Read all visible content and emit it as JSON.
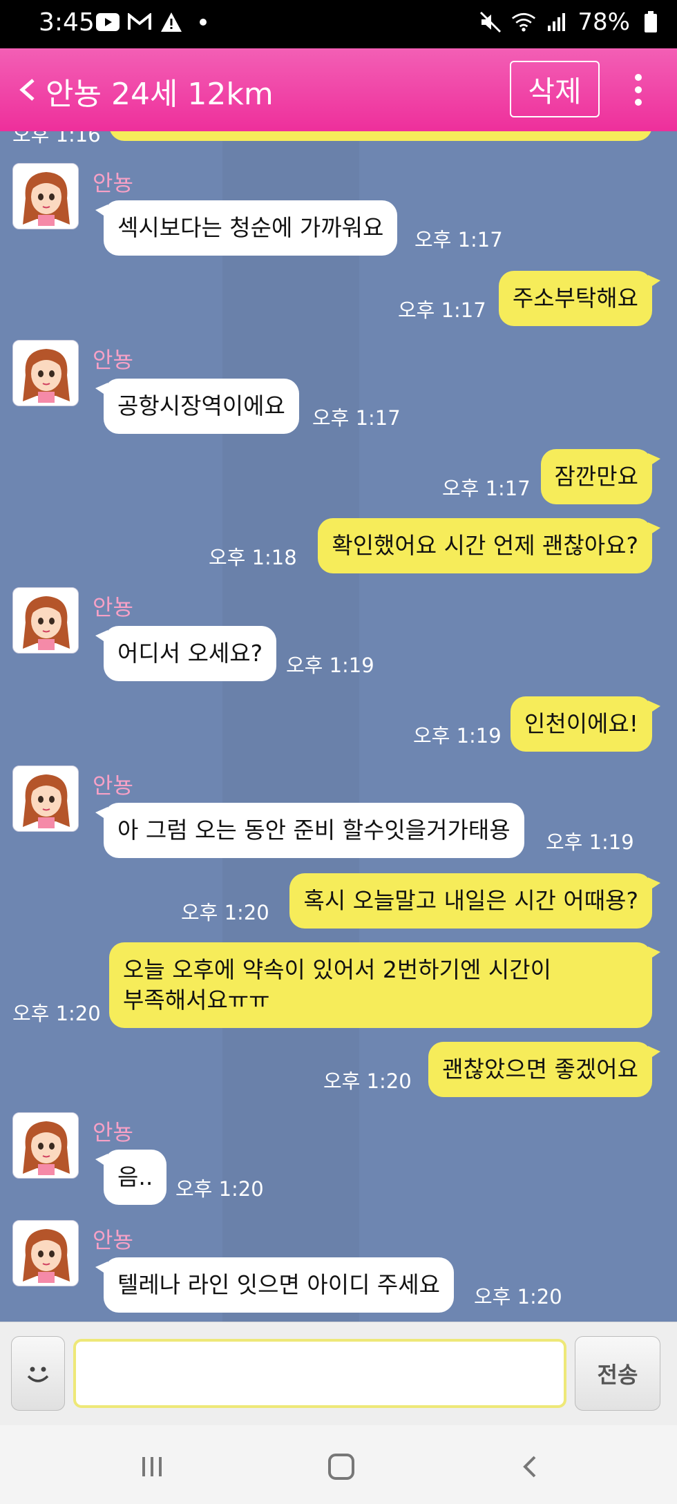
{
  "status_bar": {
    "time": "3:45",
    "battery": "78%",
    "icons_left": [
      "youtube-icon",
      "gmail-icon",
      "warning-icon",
      "dot-icon"
    ],
    "icons_right": [
      "mute-icon",
      "wifi-icon",
      "signal-icon",
      "battery-icon"
    ]
  },
  "header": {
    "title": "안뇽 24세 12km",
    "delete_label": "삭제"
  },
  "colors": {
    "header_pink": "#ee2f9b",
    "chat_bg": "#6e86b1",
    "outgoing_bubble": "#f6ec5a",
    "incoming_bubble": "#ffffff",
    "sender_name": "#f7a1c6"
  },
  "messages": [
    {
      "dir": "out",
      "text": "",
      "time": "오후 1:16",
      "partial": true
    },
    {
      "dir": "in",
      "sender": "안뇽",
      "text": "섹시보다는 청순에 가까워요",
      "time": "오후 1:17"
    },
    {
      "dir": "out",
      "text": "주소부탁해요",
      "time": "오후 1:17"
    },
    {
      "dir": "in",
      "sender": "안뇽",
      "text": "공항시장역이에요",
      "time": "오후 1:17"
    },
    {
      "dir": "out",
      "text": "잠깐만요",
      "time": "오후 1:17"
    },
    {
      "dir": "out",
      "text": "확인했어요 시간 언제 괜찮아요?",
      "time": "오후 1:18"
    },
    {
      "dir": "in",
      "sender": "안뇽",
      "text": "어디서 오세요?",
      "time": "오후 1:19"
    },
    {
      "dir": "out",
      "text": "인천이에요!",
      "time": "오후 1:19"
    },
    {
      "dir": "in",
      "sender": "안뇽",
      "text": "아 그럼 오는 동안 준비 할수잇을거가태용",
      "time": "오후 1:19"
    },
    {
      "dir": "out",
      "text": "혹시 오늘말고 내일은 시간 어때용?",
      "time": "오후 1:20"
    },
    {
      "dir": "out",
      "text_lines": [
        "오늘 오후에 약속이 있어서 2번하기엔 시간이",
        "부족해서요ㅠㅠ"
      ],
      "time": "오후 1:20"
    },
    {
      "dir": "out",
      "text": "괜찮았으면 좋겠어요",
      "time": "오후 1:20"
    },
    {
      "dir": "in",
      "sender": "안뇽",
      "text": "음..",
      "time": "오후 1:20"
    },
    {
      "dir": "in",
      "sender": "안뇽",
      "text": "텔레나 라인 잇으면 아이디 주세요",
      "time": "오후 1:20"
    }
  ],
  "composer": {
    "input_value": "",
    "send_label": "전송",
    "emoji_icon": "smiley-icon"
  },
  "nav": {
    "icons": [
      "recent-apps-icon",
      "home-icon",
      "back-icon"
    ]
  }
}
